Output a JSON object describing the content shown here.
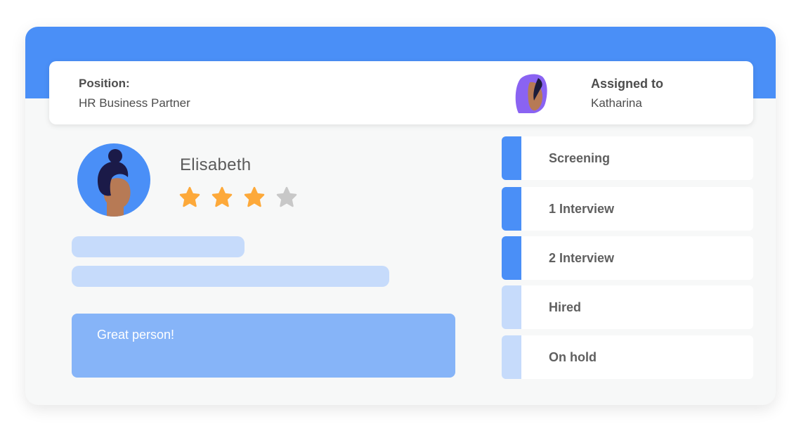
{
  "position": {
    "label": "Position:",
    "value": "HR Business Partner"
  },
  "assignment": {
    "label": "Assigned to",
    "value": "Katharina"
  },
  "candidate": {
    "name": "Elisabeth",
    "rating": 3,
    "rating_max": 4
  },
  "note": {
    "text": "Great person!"
  },
  "stages": [
    {
      "label": "Screening",
      "completed": true
    },
    {
      "label": "1  Interview",
      "completed": true
    },
    {
      "label": "2  Interview",
      "completed": true
    },
    {
      "label": "Hired",
      "completed": false
    },
    {
      "label": "On hold",
      "completed": false
    }
  ],
  "colors": {
    "accent": "#4a8ff7",
    "stage_done": "#4a8ff7",
    "stage_pending": "#c6dbfb",
    "star_filled": "#fda93a",
    "star_empty": "#c8c8c8",
    "note_bg": "#86b4f8"
  },
  "icons": {
    "assignee_avatar": "avatar-woman-headscarf-icon",
    "candidate_avatar": "avatar-woman-bun-icon",
    "star": "star-icon"
  }
}
